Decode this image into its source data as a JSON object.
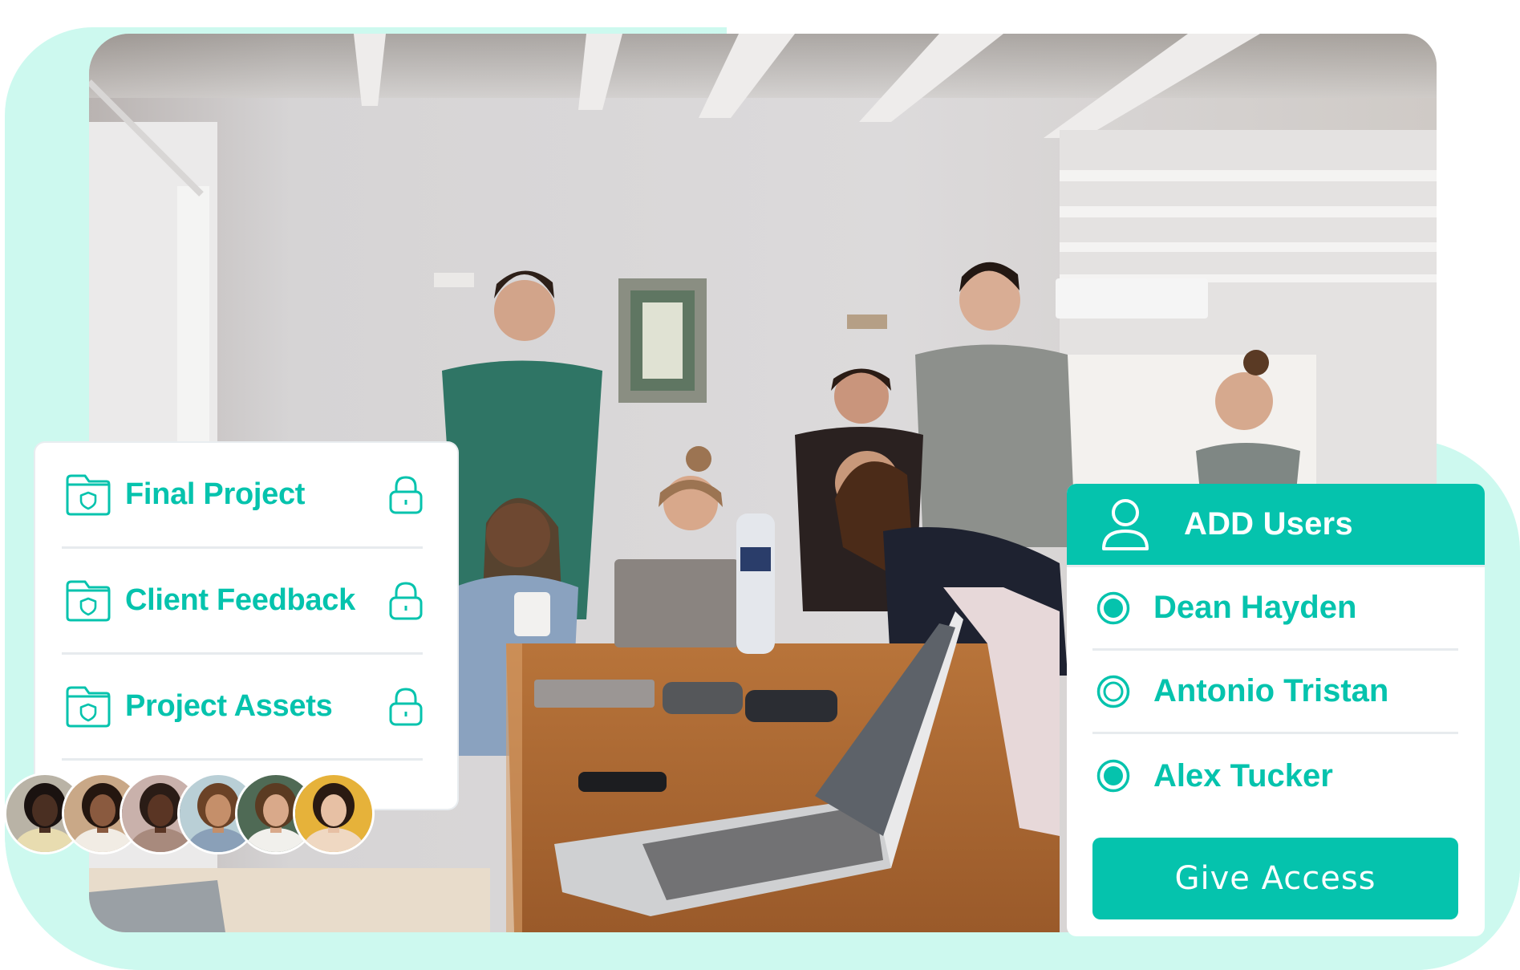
{
  "colors": {
    "accent": "#05c3ad",
    "mint_background": "#cdf9ef",
    "divider": "#e7ebee",
    "card_background": "#ffffff"
  },
  "photo": {
    "description": "Team of seven people gathered around a wooden table with laptops"
  },
  "folders": {
    "items": [
      {
        "label": "Final Project",
        "icon": "folder-shield-icon",
        "status_icon": "lock-icon"
      },
      {
        "label": "Client Feedback",
        "icon": "folder-shield-icon",
        "status_icon": "lock-icon"
      },
      {
        "label": "Project Assets",
        "icon": "folder-shield-icon",
        "status_icon": "lock-icon"
      }
    ]
  },
  "avatars": {
    "count": 6,
    "items": [
      {
        "name": "avatar-1",
        "bg": "#b9b3a6",
        "skin": "#4a2f22",
        "hair": "#1a1210",
        "shirt": "#e8dcb0"
      },
      {
        "name": "avatar-2",
        "bg": "#c9a887",
        "skin": "#8a5a3f",
        "hair": "#24160f",
        "shirt": "#f1ece4"
      },
      {
        "name": "avatar-3",
        "bg": "#c9b1ab",
        "skin": "#5a3524",
        "hair": "#2a1c16",
        "shirt": "#a88a7d"
      },
      {
        "name": "avatar-4",
        "bg": "#b9cfd6",
        "skin": "#c58f6a",
        "hair": "#6b4226",
        "shirt": "#8aa0b8"
      },
      {
        "name": "avatar-5",
        "bg": "#4f6a55",
        "skin": "#d9a98a",
        "hair": "#5b3b22",
        "shirt": "#f1f0ec"
      },
      {
        "name": "avatar-6",
        "bg": "#e6b23a",
        "skin": "#e7c0a4",
        "hair": "#2a1a12",
        "shirt": "#efd8c2"
      }
    ]
  },
  "users_panel": {
    "title": "ADD Users",
    "icon": "user-icon",
    "users": [
      {
        "name": "Dean Hayden",
        "selected": true
      },
      {
        "name": "Antonio Tristan",
        "selected": false
      },
      {
        "name": "Alex Tucker",
        "selected": true
      }
    ],
    "action_label": "Give Access"
  }
}
